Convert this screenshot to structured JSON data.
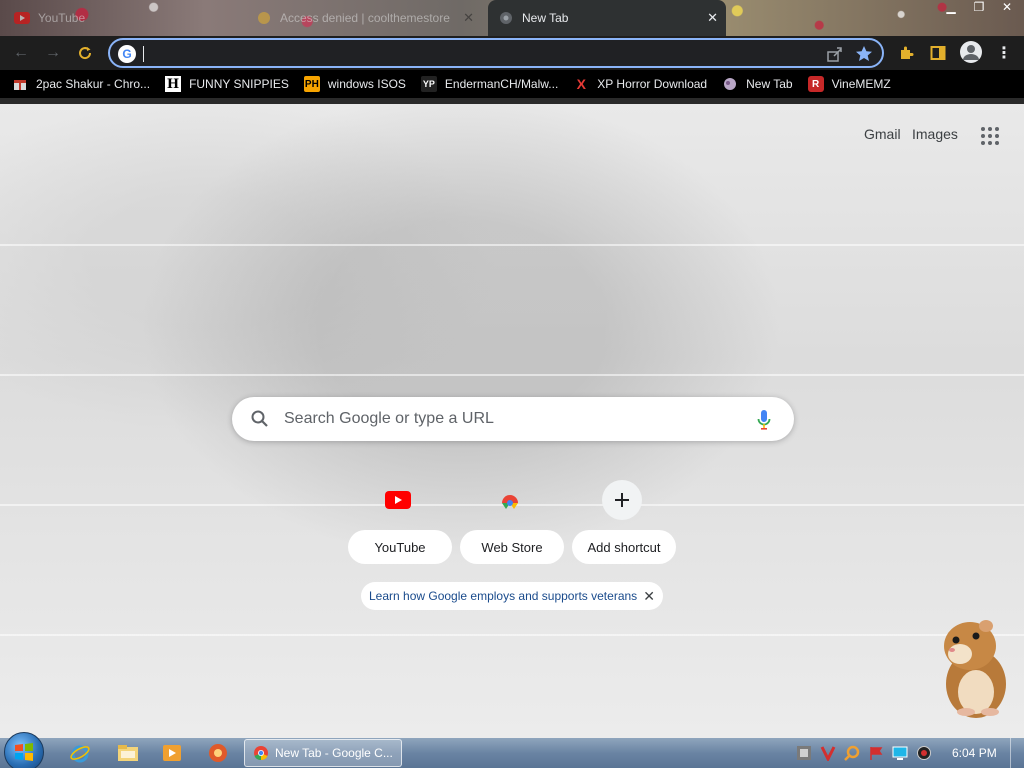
{
  "tabs": [
    {
      "title": "YouTube"
    },
    {
      "title": "Access denied | coolthemestore"
    },
    {
      "title": "New Tab"
    }
  ],
  "omnibox": {
    "value": ""
  },
  "bookmarks": [
    {
      "label": "2pac Shakur - Chro...",
      "icon": "gift-icon"
    },
    {
      "label": "FUNNY SNIPPIES",
      "icon": "h-icon"
    },
    {
      "label": "windows ISOS",
      "icon": "ph-icon"
    },
    {
      "label": "EndermanCH/Malw...",
      "icon": "yp-icon"
    },
    {
      "label": "XP Horror Download",
      "icon": "x-icon"
    },
    {
      "label": "New Tab",
      "icon": "globe-icon"
    },
    {
      "label": "VineMEMZ",
      "icon": "r-icon"
    }
  ],
  "header": {
    "gmail": "Gmail",
    "images": "Images"
  },
  "search": {
    "placeholder": "Search Google or type a URL"
  },
  "shortcuts": [
    {
      "label": "YouTube",
      "icon": "youtube-icon"
    },
    {
      "label": "Web Store",
      "icon": "chrome-webstore-icon"
    },
    {
      "label": "Add shortcut",
      "icon": "plus-icon"
    }
  ],
  "promo": {
    "text": "Learn how Google employs and supports veterans"
  },
  "taskbar": {
    "active_window": "New Tab - Google C...",
    "clock": "6:04 PM"
  },
  "colors": {
    "omnibox_focus": "#8ab4f8",
    "toolbar_bg": "#1e1e1e",
    "bookmarks_bg": "#000000",
    "promo_link": "#1a4b8c"
  }
}
